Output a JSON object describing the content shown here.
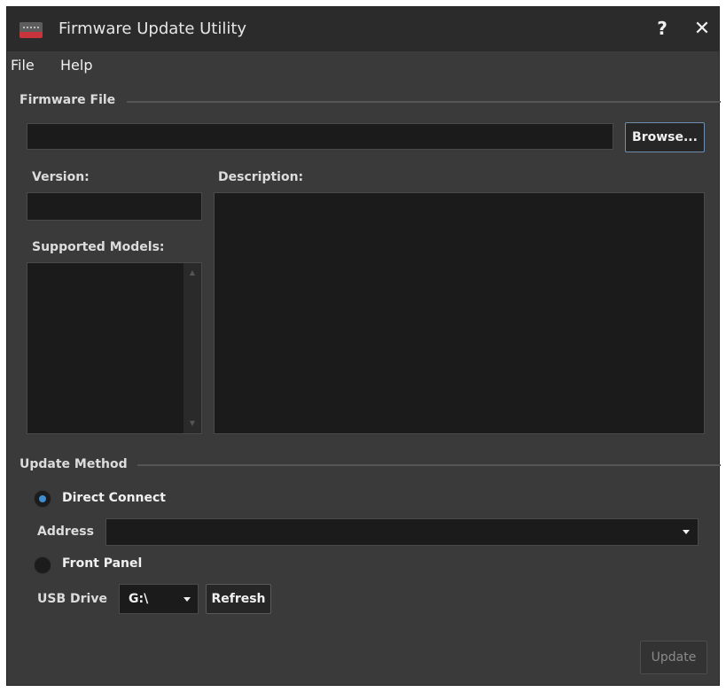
{
  "window": {
    "title": "Firmware Update Utility",
    "help_glyph": "?",
    "close_glyph": "✕"
  },
  "menu": {
    "items": [
      {
        "label": "File"
      },
      {
        "label": "Help"
      }
    ]
  },
  "firmware": {
    "group_label": "Firmware File",
    "file_path": "",
    "browse_label": "Browse...",
    "version_label": "Version:",
    "version_value": "",
    "description_label": "Description:",
    "description_value": "",
    "models_label": "Supported Models:",
    "models": []
  },
  "update_method": {
    "group_label": "Update Method",
    "direct_connect_label": "Direct Connect",
    "direct_connect_selected": true,
    "address_label": "Address",
    "address_value": "",
    "front_panel_label": "Front Panel",
    "front_panel_selected": false,
    "usb_drive_label": "USB Drive",
    "usb_drive_value": "G:\\",
    "refresh_label": "Refresh"
  },
  "footer": {
    "update_label": "Update",
    "update_enabled": false
  },
  "colors": {
    "window_bg": "#3a3a3a",
    "titlebar_bg": "#2b2b2b",
    "field_bg": "#1b1b1b",
    "accent": "#3f8ed0",
    "icon_red": "#c8343c"
  }
}
